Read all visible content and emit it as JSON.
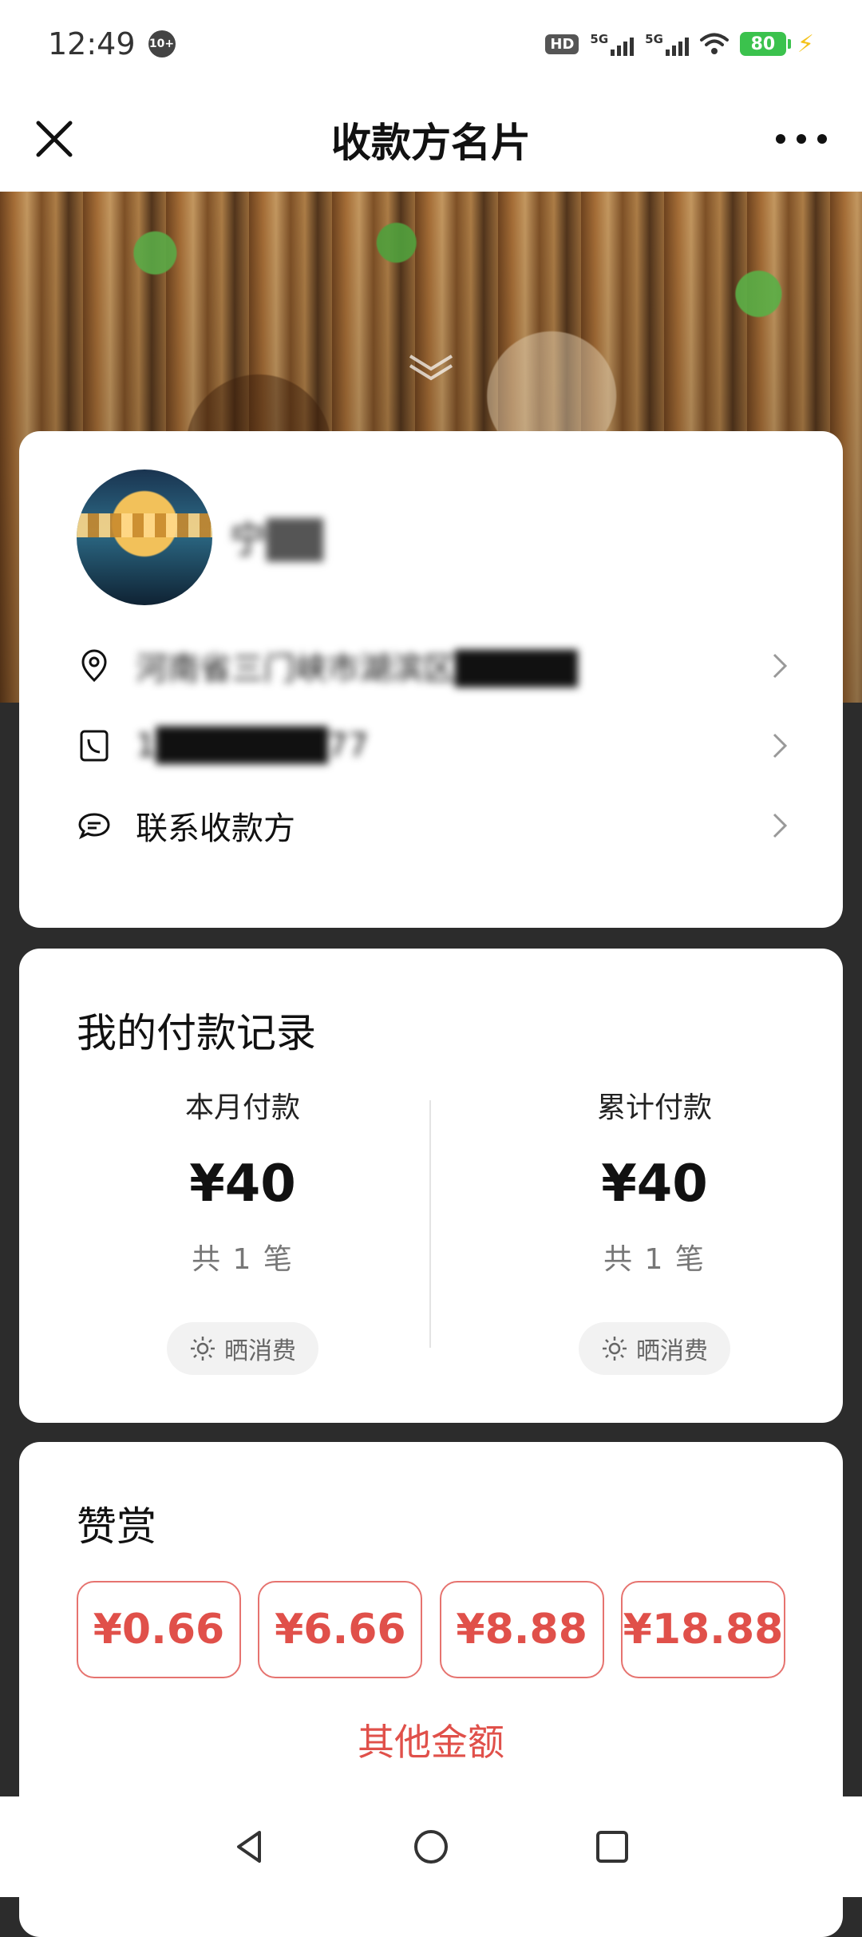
{
  "status_bar": {
    "time": "12:49",
    "notification_badge": "10+",
    "hd_label": "HD",
    "network_1": "5G",
    "network_2": "5G",
    "battery_level": "80"
  },
  "header": {
    "title": "收款方名片"
  },
  "profile": {
    "payee_name": "宁██",
    "address": "河南省三门峡市湖滨区█████",
    "phone": "1███████77",
    "contact_label": "联系收款方"
  },
  "records": {
    "title": "我的付款记录",
    "month": {
      "label": "本月付款",
      "amount": "¥40",
      "count": "共 1 笔",
      "share_label": "晒消费"
    },
    "total": {
      "label": "累计付款",
      "amount": "¥40",
      "count": "共 1 笔",
      "share_label": "晒消费"
    }
  },
  "reward": {
    "title": "赞赏",
    "amounts": [
      "¥0.66",
      "¥6.66",
      "¥8.88",
      "¥18.88"
    ],
    "other_label": "其他金额"
  },
  "colors": {
    "accent_red": "#e0504a",
    "battery_green": "#3bc24d"
  }
}
